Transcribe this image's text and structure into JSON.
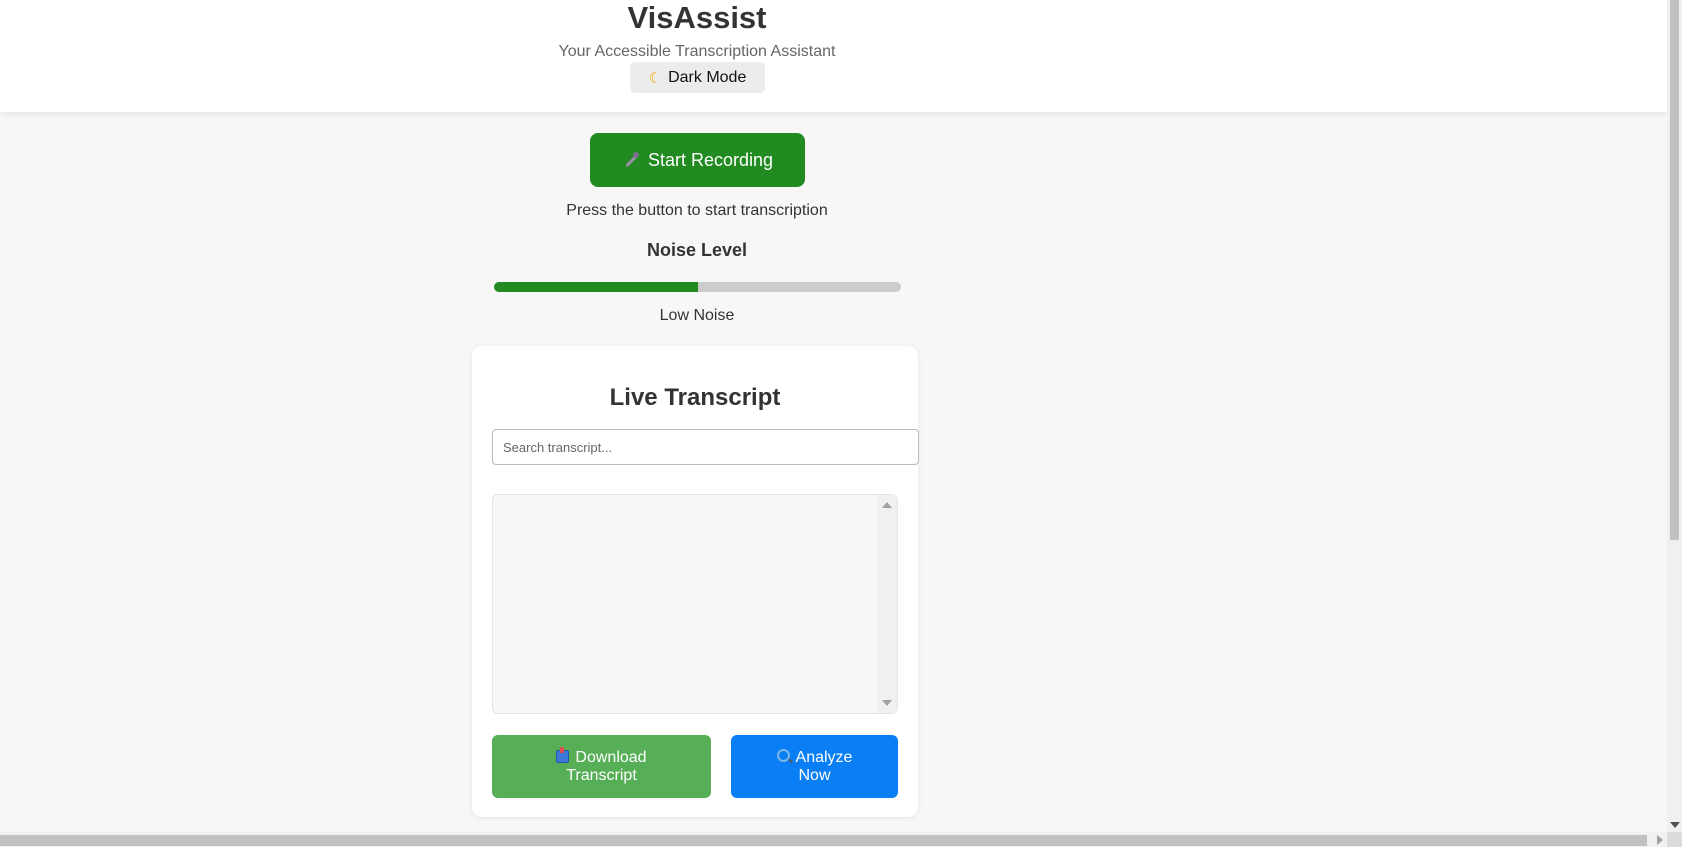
{
  "header": {
    "title": "VisAssist",
    "subtitle": "Your Accessible Transcription Assistant",
    "dark_mode_label": "Dark Mode",
    "dark_mode_icon": "moon-icon"
  },
  "recording": {
    "button_label": "Start Recording",
    "button_icon": "microphone-icon",
    "button_color": "#218a21",
    "status_text": "Press the button to start transcription"
  },
  "noise": {
    "title": "Noise Level",
    "level_percent": 50,
    "label": "Low Noise",
    "fill_color": "#218a21"
  },
  "transcript": {
    "title": "Live Transcript",
    "search_placeholder": "Search transcript...",
    "search_value": "",
    "content": "",
    "download_label_line1": "Download",
    "download_label_line2": "Transcript",
    "download_icon": "inbox-tray-icon",
    "download_color": "#56ae56",
    "analyze_label_line1": "Analyze",
    "analyze_label_line2": "Now",
    "analyze_icon": "magnifier-icon",
    "analyze_color": "#0a7ff5"
  }
}
